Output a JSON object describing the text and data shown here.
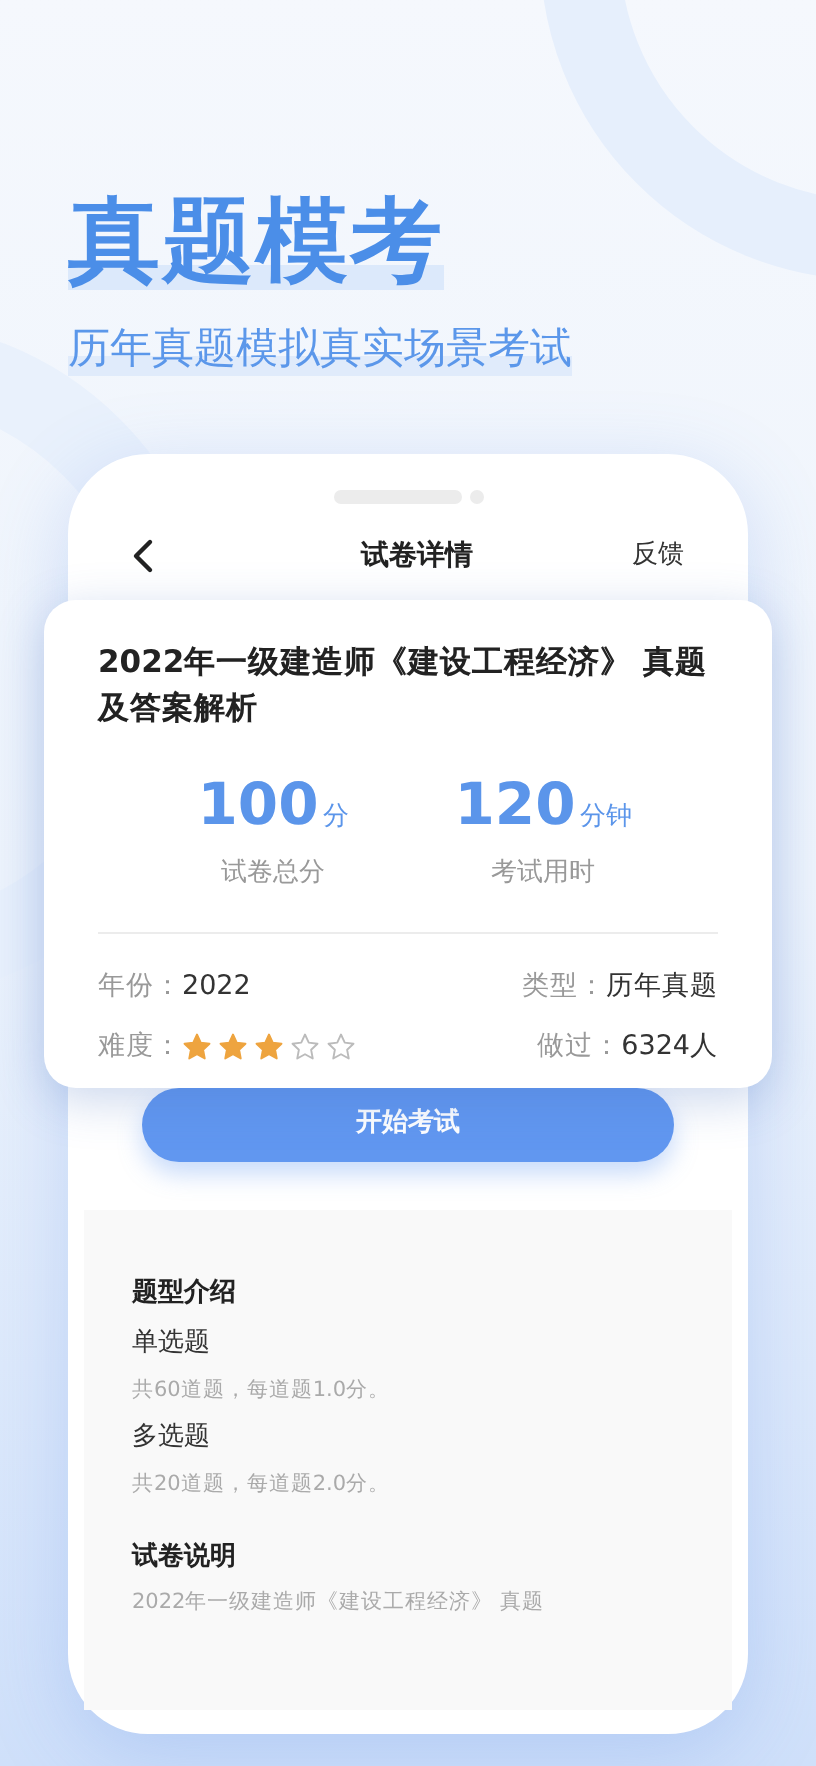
{
  "headline": "真题模考",
  "subheadline": "历年真题模拟真实场景考试",
  "nav": {
    "title": "试卷详情",
    "action": "反馈"
  },
  "paper": {
    "title": "2022年一级建造师《建设工程经济》 真题及答案解析",
    "stats": [
      {
        "value": "100",
        "unit": "分",
        "label": "试卷总分"
      },
      {
        "value": "120",
        "unit": "分钟",
        "label": "考试用时"
      }
    ],
    "year_label": "年份：",
    "year": "2022",
    "type_label": "类型：",
    "type": "历年真题",
    "difficulty_label": "难度：",
    "stars": 3,
    "done_label": "做过：",
    "done": "6324人"
  },
  "start_button": "开始考试",
  "sections": [
    {
      "title": "题型介绍",
      "items": [
        {
          "name": "单选题",
          "note": "共60道题，每道题1.0分。"
        },
        {
          "name": "多选题",
          "note": "共20道题，每道题2.0分。"
        }
      ]
    },
    {
      "title": "试卷说明",
      "text": "2022年一级建造师《建设工程经济》 真题"
    }
  ]
}
